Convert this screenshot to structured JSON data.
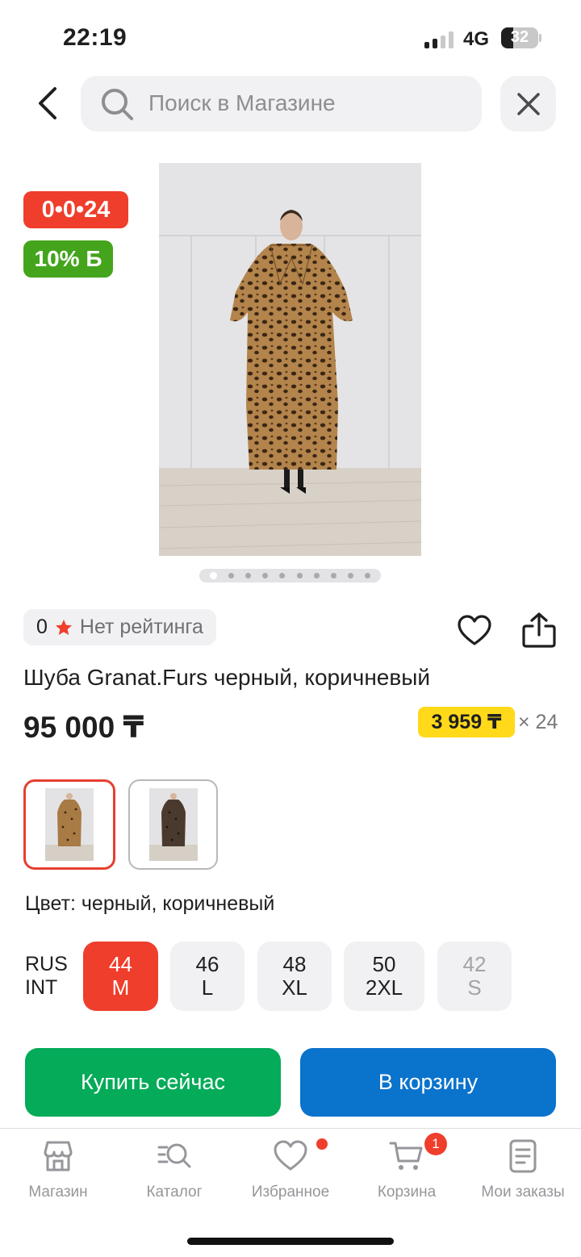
{
  "status_bar": {
    "time": "22:19",
    "network": "4G",
    "battery": "32",
    "battery_level": 0.32
  },
  "header": {
    "search_placeholder": "Поиск в Магазине"
  },
  "badges": {
    "timer": "0•0•24",
    "bonus": "10% Б"
  },
  "gallery": {
    "image_count": 10,
    "active_index": 0
  },
  "product": {
    "rating_count": "0",
    "rating_label": "Нет рейтинга",
    "title": "Шуба Granat.Furs черный, коричневый",
    "price": "95 000 ₸",
    "installment_price": "3 959 ₸",
    "installment_months": "× 24",
    "color_label": "Цвет: черный, коричневый"
  },
  "sizes": {
    "axis_top": "RUS",
    "axis_bottom": "INT",
    "options": [
      {
        "rus": "44",
        "int": "M",
        "state": "selected"
      },
      {
        "rus": "46",
        "int": "L",
        "state": "available"
      },
      {
        "rus": "48",
        "int": "XL",
        "state": "available"
      },
      {
        "rus": "50",
        "int": "2XL",
        "state": "available"
      },
      {
        "rus": "42",
        "int": "S",
        "state": "unavailable"
      }
    ]
  },
  "actions": {
    "buy_now": "Купить сейчас",
    "add_to_cart": "В корзину"
  },
  "bottom_nav": {
    "items": [
      {
        "label": "Магазин",
        "icon": "store-icon"
      },
      {
        "label": "Каталог",
        "icon": "catalog-search-icon"
      },
      {
        "label": "Избранное",
        "icon": "heart-icon"
      },
      {
        "label": "Корзина",
        "icon": "cart-icon"
      },
      {
        "label": "Мои заказы",
        "icon": "orders-icon"
      }
    ],
    "cart_badge": "1"
  },
  "colors": {
    "accent_red": "#ef3e2c",
    "bonus_green": "#44a51d",
    "buy_green": "#04ab58",
    "cart_blue": "#0a73cc",
    "installment_yellow": "#ffd91a"
  }
}
